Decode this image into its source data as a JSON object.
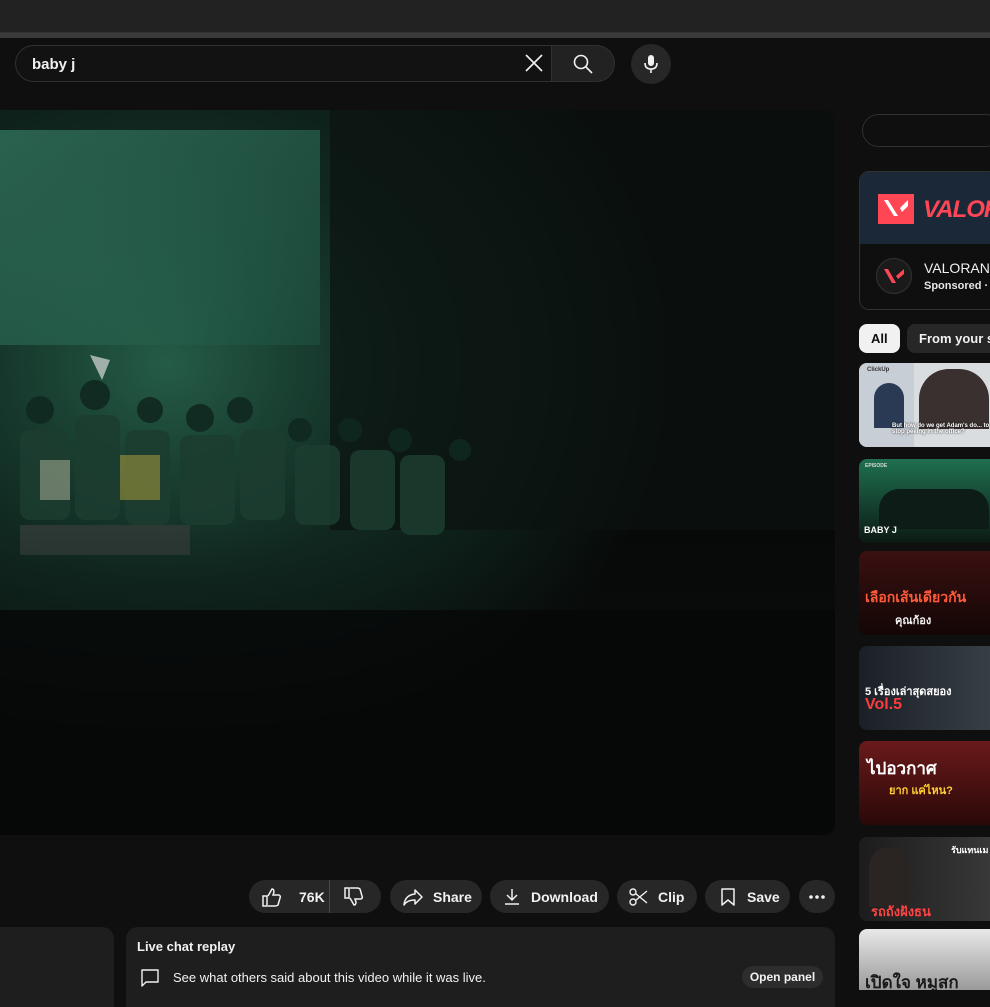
{
  "search": {
    "query": "baby j"
  },
  "actions": {
    "like_count": "76K",
    "share_label": "Share",
    "download_label": "Download",
    "clip_label": "Clip",
    "save_label": "Save"
  },
  "live_chat": {
    "title": "Live chat replay",
    "description": "See what others said about this video while it was live.",
    "open_panel_label": "Open panel"
  },
  "ad": {
    "banner_text": "VALOR",
    "title": "VALORAN",
    "sponsored": "Sponsored ·"
  },
  "chips": {
    "all": "All",
    "from_your": "From your s"
  },
  "thumbnails": [
    {
      "caption": "But how do we get Adam's do... to stop peeing in the office?",
      "corner": "ClickUp"
    },
    {
      "caption": "BABY J",
      "corner": "EPISODE"
    },
    {
      "caption": "เลือกเส้นเดียวกัน",
      "corner": "คุณก้อง"
    },
    {
      "caption": "5 เรื่องเล่าสุดสยอง",
      "corner": "Vol.5"
    },
    {
      "caption": "ไปอวกาศ",
      "corner": "ยาก แค่ไหน?"
    },
    {
      "caption": "รถถังฝังธน",
      "corner": "รับแทนเม"
    },
    {
      "caption": "เปิดใจ หมูสก",
      "corner": ""
    }
  ],
  "colors": {
    "background": "#0f0f0f",
    "surface": "#272727",
    "valorant_red": "#ff4655",
    "stage_green": "#1f5a45"
  }
}
